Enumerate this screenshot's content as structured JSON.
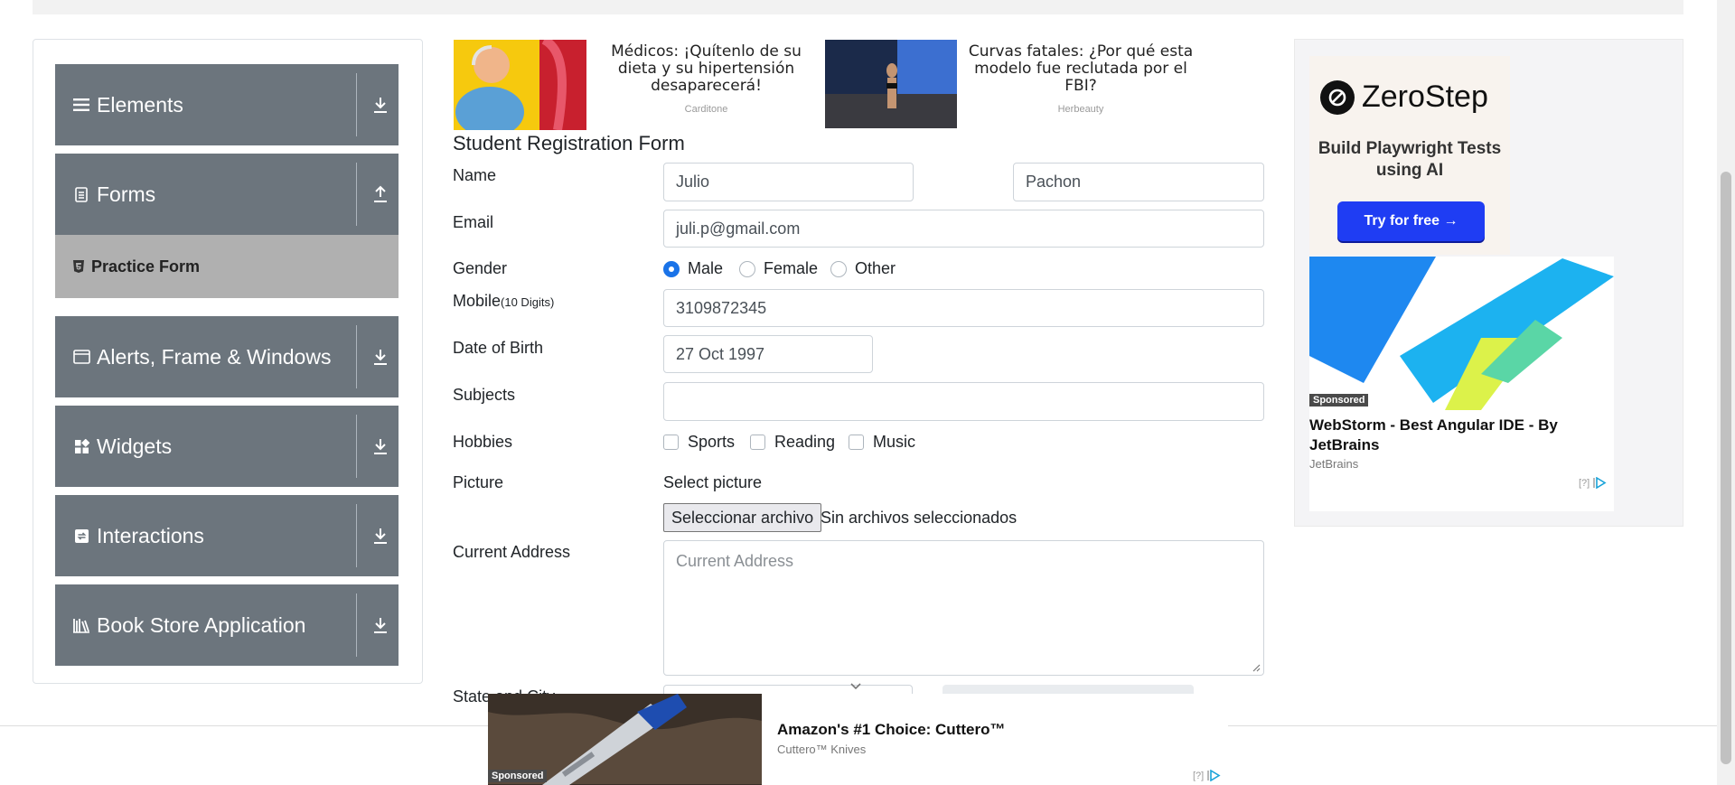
{
  "sidebar": {
    "groups": [
      {
        "label": "Elements",
        "icon": "hamburger-icon",
        "arrow": "download-arrow-icon"
      },
      {
        "label": "Forms",
        "icon": "document-icon",
        "arrow": "upload-arrow-icon"
      },
      {
        "label": "Alerts, Frame & Windows",
        "icon": "window-icon",
        "arrow": "download-arrow-icon"
      },
      {
        "label": "Widgets",
        "icon": "widgets-icon",
        "arrow": "download-arrow-icon"
      },
      {
        "label": "Interactions",
        "icon": "interaction-icon",
        "arrow": "download-arrow-icon"
      },
      {
        "label": "Book Store Application",
        "icon": "books-icon",
        "arrow": "download-arrow-icon"
      }
    ],
    "active_item": {
      "label": "Practice Form",
      "icon": "html5-icon"
    }
  },
  "ads_top": [
    {
      "text": "Médicos: ¡Quítenlo de su dieta y su hipertensión desaparecerá!",
      "source": "Carditone"
    },
    {
      "text": "Curvas fatales: ¿Por qué esta modelo fue reclutada por el FBI?",
      "source": "Herbeauty"
    }
  ],
  "form": {
    "title": "Student Registration Form",
    "name_label": "Name",
    "first_name": "Julio",
    "last_name": "Pachon",
    "email_label": "Email",
    "email": "juli.p@gmail.com",
    "gender_label": "Gender",
    "gender_options": [
      "Male",
      "Female",
      "Other"
    ],
    "gender_selected": "Male",
    "mobile_label": "Mobile",
    "mobile_hint": "(10 Digits)",
    "mobile": "3109872345",
    "dob_label": "Date of Birth",
    "dob": "27 Oct 1997",
    "subjects_label": "Subjects",
    "hobbies_label": "Hobbies",
    "hobbies": [
      "Sports",
      "Reading",
      "Music"
    ],
    "picture_label": "Picture",
    "picture_hint": "Select picture",
    "file_button": "Seleccionar archivo",
    "file_status": "Sin archivos seleccionados",
    "address_label": "Current Address",
    "address_placeholder": "Current Address",
    "state_label": "State and City"
  },
  "side_ad": {
    "brand": "ZeroStep",
    "subtitle": "Build Playwright Tests using AI",
    "cta": "Try for free →",
    "sponsored": "Sponsored",
    "title": "WebStorm - Best Angular IDE - By JetBrains",
    "advertiser": "JetBrains",
    "choice": "[?]"
  },
  "bottom_ad": {
    "title": "Amazon's #1 Choice: Cuttero™",
    "advertiser": "Cuttero™ Knives",
    "sponsored": "Sponsored",
    "choice": "[?]"
  },
  "colors": {
    "sidebar_group": "#6c757d",
    "active_item": "#b0b0b0",
    "radio_selected": "#1a73e8",
    "cta_button": "#1f3df3"
  }
}
